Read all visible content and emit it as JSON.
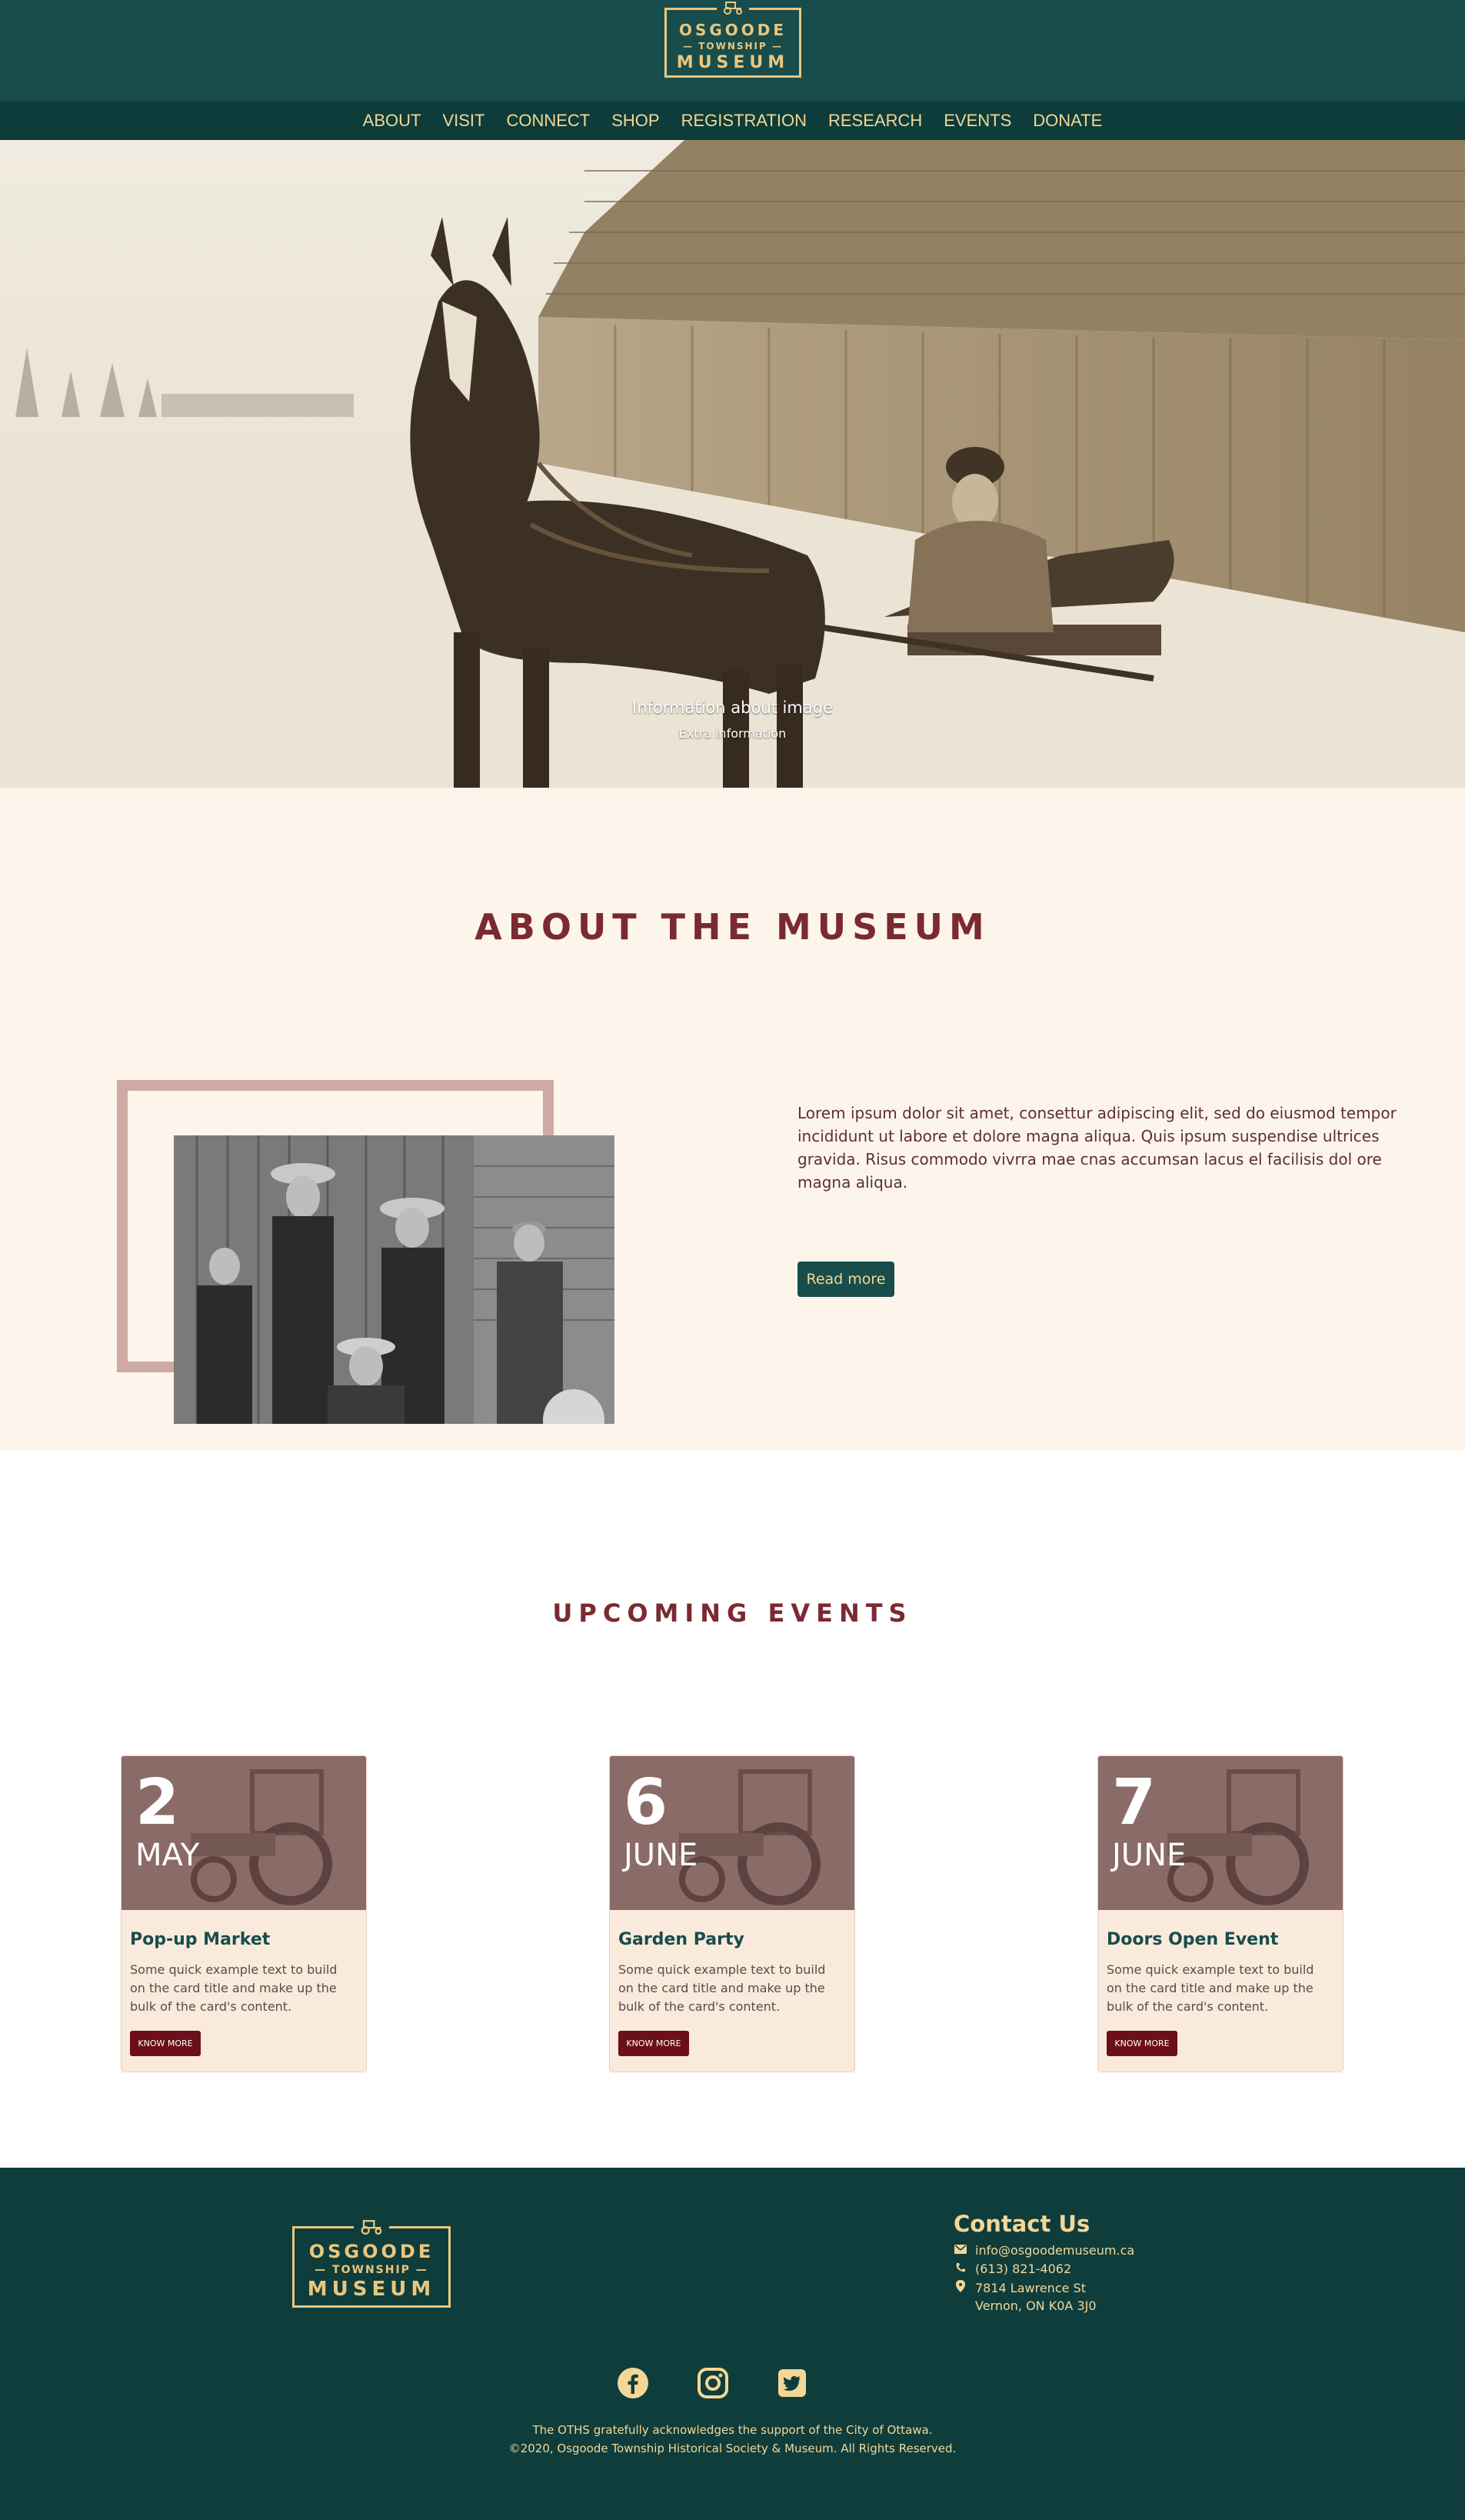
{
  "header": {
    "logo": {
      "line1": "OSGOODE",
      "line2": "— TOWNSHIP —",
      "line3": "MUSEUM"
    },
    "nav": [
      "ABOUT",
      "VISIT",
      "CONNECT",
      "SHOP",
      "REGISTRATION",
      "RESEARCH",
      "EVENTS",
      "DONATE"
    ]
  },
  "hero": {
    "caption": "Information about image",
    "subcaption": "Extra information"
  },
  "about": {
    "title": "ABOUT THE MUSEUM",
    "text": "Lorem ipsum dolor sit amet, consettur adipiscing elit, sed do eiusmod tempor incididunt ut labore et dolore magna aliqua. Quis ipsum suspendise ultrices gravida. Risus commodo vivrra mae cnas accumsan lacus el facilisis dol ore magna aliqua.",
    "button": "Read more"
  },
  "events": {
    "title": "UPCOMING EVENTS",
    "cards": [
      {
        "day": "2",
        "month": "MAY",
        "title": "Pop-up Market",
        "text": "Some quick example text to build on the card title and make up the bulk of the card's content.",
        "button": "KNOW MORE"
      },
      {
        "day": "6",
        "month": "JUNE",
        "title": "Garden Party",
        "text": "Some quick example text to build on the card title and make up the bulk of the card's content.",
        "button": "KNOW MORE"
      },
      {
        "day": "7",
        "month": "JUNE",
        "title": "Doors Open Event",
        "text": "Some quick example text to build on the card title and make up the bulk of the card's content.",
        "button": "KNOW MORE"
      }
    ]
  },
  "footer": {
    "logo": {
      "line1": "OSGOODE",
      "line2": "— TOWNSHIP —",
      "line3": "MUSEUM"
    },
    "contact": {
      "title": "Contact Us",
      "email": "info@osgoodemuseum.ca",
      "phone": "(613) 821-4062",
      "address1": "7814 Lawrence St",
      "address2": "Vernon, ON K0A 3J0"
    },
    "social_icons": [
      "facebook-icon",
      "instagram-icon",
      "twitter-icon"
    ],
    "acknowledgement": "The OTHS gratefully acknowledges the support of the City of Ottawa.",
    "copyright": "©2020, Osgoode Township Historical Society & Museum. All Rights Reserved."
  },
  "colors": {
    "header_bg": "#184d4b",
    "nav_bg": "#0e3c3a",
    "accent_gold": "#f3d796",
    "title_maroon": "#7a2a30",
    "about_bg": "#fdf5ec",
    "card_bg": "#f9eadc",
    "button_maroon": "#6b0f19",
    "footer_bg": "#0f3d3c"
  }
}
